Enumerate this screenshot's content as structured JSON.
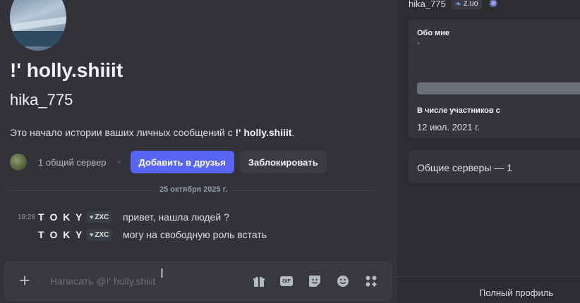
{
  "profile": {
    "display_name": "!' holly.shiiit",
    "username": "hika_775",
    "intro_prefix": "Это начало истории ваших личных сообщений с ",
    "intro_name": "!' holly.shiiit",
    "intro_suffix": ".",
    "mutual_servers": "1 общий сервер",
    "add_friend_label": "Добавить в друзья",
    "block_label": "Заблокировать"
  },
  "chat": {
    "date_divider": "25 октября 2025 г.",
    "messages": [
      {
        "time": "19:28",
        "author": "T O K Y O",
        "tag": "ZXC",
        "text": "привет, нашла людей ?"
      },
      {
        "time": "",
        "author": "T O K Y O",
        "tag": "ZXC",
        "text": "могу на свободную роль встать"
      }
    ]
  },
  "composer": {
    "placeholder": "Написать @!' holly.shiiit",
    "gif_label": "GIF",
    "icons": [
      "plus-icon",
      "gift-icon",
      "gif-icon",
      "sticker-icon",
      "emoji-icon",
      "apps-icon"
    ]
  },
  "panel": {
    "username": "hika_775",
    "badge_text": "z.uo",
    "about_title": "Обо мне",
    "about_text": "`",
    "member_since_title": "В числе участников с",
    "member_since_date": "12 июл. 2021 г.",
    "mutual_servers": "Общие серверы — 1",
    "full_profile": "Полный профиль"
  },
  "colors": {
    "accent": "#5865f2",
    "chat_bg": "#323339",
    "panel_bg": "#2b2d31"
  }
}
